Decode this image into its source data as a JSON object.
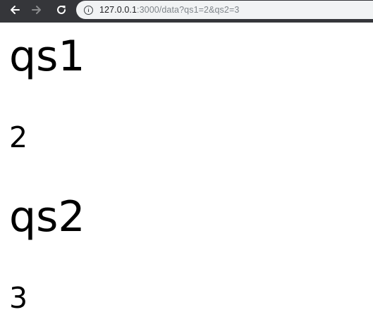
{
  "browser": {
    "url_host": "127.0.0.1",
    "url_rest": ":3000/data?qs1=2&qs2=3"
  },
  "page": {
    "items": [
      {
        "key": "qs1",
        "value": "2"
      },
      {
        "key": "qs2",
        "value": "3"
      }
    ]
  }
}
